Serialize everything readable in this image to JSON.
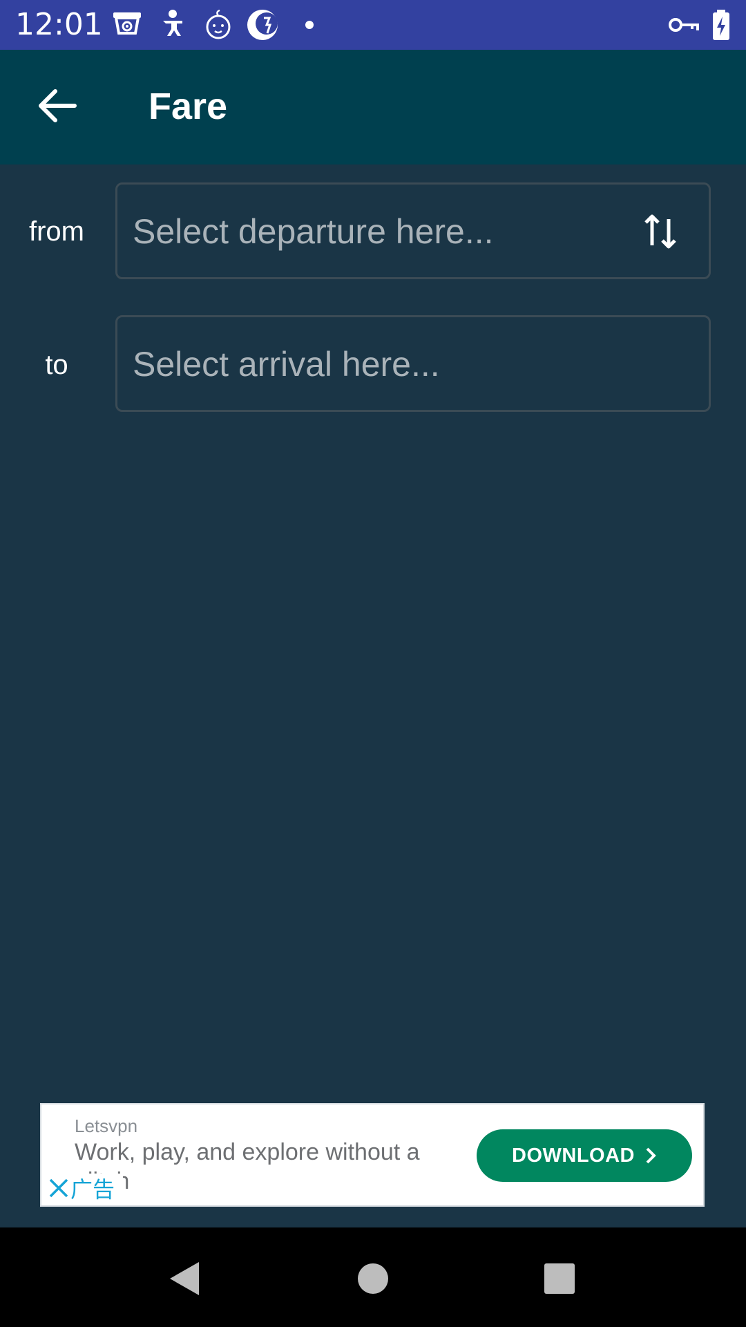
{
  "status_bar": {
    "time": "12:01",
    "icons": [
      "camera-app-icon",
      "baby-app-icon",
      "baby-face-app-icon",
      "moon-app-icon",
      "notification-dot-icon",
      "vpn-key-icon",
      "battery-charging-icon"
    ]
  },
  "app_bar": {
    "title": "Fare",
    "back_icon": "arrow-left-icon"
  },
  "form": {
    "from_label": "from",
    "from_placeholder": "Select departure here...",
    "to_label": "to",
    "to_placeholder": "Select arrival here...",
    "swap_icon": "swap-vertical-icon"
  },
  "ad": {
    "advertiser": "Letsvpn",
    "headline": "Work, play, and explore without a glitch",
    "button_label": "DOWNLOAD",
    "ad_label": "广告",
    "colors": {
      "button": "#01875f",
      "ad_choice": "#15a4d6"
    }
  },
  "nav_bar": {
    "buttons": [
      "back-triangle-icon",
      "home-circle-icon",
      "recents-square-icon"
    ]
  },
  "colors": {
    "status_bar": "#3341a0",
    "app_bar": "#00404f",
    "background": "#1a3546"
  }
}
